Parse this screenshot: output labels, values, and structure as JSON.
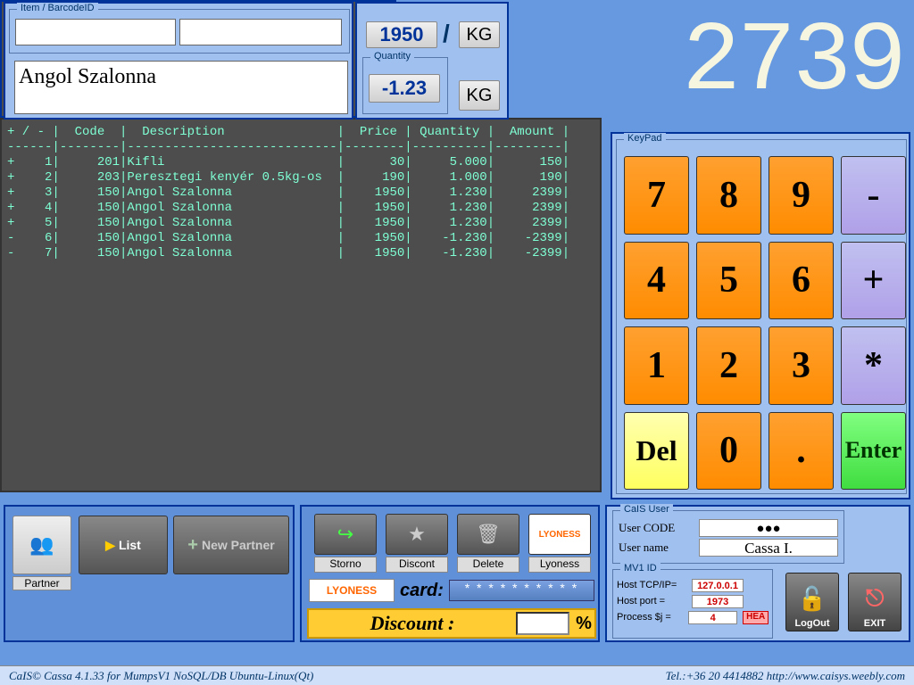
{
  "item": {
    "legend": "Item / BarcodeID",
    "barcode1": "",
    "barcode2": "",
    "description": "Angol Szalonna"
  },
  "price_qty": {
    "price": "1950",
    "unit": "KG",
    "qty_legend": "Quantity",
    "quantity": "-1.23"
  },
  "display": "2739",
  "table": {
    "headers": [
      "+ / -",
      "Code",
      "Description",
      "Price",
      "Quantity",
      "Amount"
    ],
    "rows": [
      {
        "pm": "+",
        "n": "1",
        "code": "201",
        "desc": "Kifli",
        "price": "30",
        "qty": "5.000",
        "amount": "150"
      },
      {
        "pm": "+",
        "n": "2",
        "code": "203",
        "desc": "Peresztegi kenyér 0.5kg-os",
        "price": "190",
        "qty": "1.000",
        "amount": "190"
      },
      {
        "pm": "+",
        "n": "3",
        "code": "150",
        "desc": "Angol Szalonna",
        "price": "1950",
        "qty": "1.230",
        "amount": "2399"
      },
      {
        "pm": "+",
        "n": "4",
        "code": "150",
        "desc": "Angol Szalonna",
        "price": "1950",
        "qty": "1.230",
        "amount": "2399"
      },
      {
        "pm": "+",
        "n": "5",
        "code": "150",
        "desc": "Angol Szalonna",
        "price": "1950",
        "qty": "1.230",
        "amount": "2399"
      },
      {
        "pm": "-",
        "n": "6",
        "code": "150",
        "desc": "Angol Szalonna",
        "price": "1950",
        "qty": "-1.230",
        "amount": "-2399"
      },
      {
        "pm": "-",
        "n": "7",
        "code": "150",
        "desc": "Angol Szalonna",
        "price": "1950",
        "qty": "-1.230",
        "amount": "-2399"
      }
    ]
  },
  "keypad": {
    "legend": "KeyPad",
    "keys": [
      "7",
      "8",
      "9",
      "-",
      "4",
      "5",
      "6",
      "+",
      "1",
      "2",
      "3",
      "*",
      "Del",
      "0",
      ".",
      "Enter"
    ]
  },
  "partner": {
    "partner": "Partner",
    "list": "List",
    "new_partner": "New Partner"
  },
  "actions": {
    "storno": "Storno",
    "discont": "Discont",
    "delete": "Delete",
    "lyoness": "Lyoness",
    "lyoness_logo": "LYONESS",
    "card_label": "card:",
    "card_value": "* * * * * * * * * *",
    "discount_label": "Discount    :",
    "discount_value": "",
    "discount_pct": "%"
  },
  "user": {
    "legend": "CaIS User",
    "code_label": "User CODE",
    "code_value": "●●●",
    "name_label": "User name",
    "name_value": "Cassa I."
  },
  "mv1": {
    "legend": "MV1 ID",
    "host_ip_label": "Host TCP/IP=",
    "host_ip": "127.0.0.1",
    "host_port_label": "Host port   =",
    "host_port": "1973",
    "process_label": "Process $j  =",
    "process": "4",
    "hea": "HEA"
  },
  "bottom_buttons": {
    "logout": "LogOut",
    "exit": "EXIT"
  },
  "status": {
    "left": "CaIS©  Cassa 4.1.33 for MumpsV1 NoSQL/DB Ubuntu-Linux(Qt)",
    "right": "Tel.:+36 20 4414882 http://www.caisys.weebly.com"
  }
}
